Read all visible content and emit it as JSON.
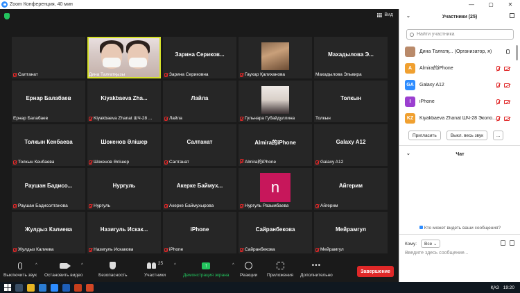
{
  "window": {
    "title": "Zoom Конференция, 40 мин",
    "controls": [
      "—",
      "▢",
      "✕"
    ]
  },
  "view_button": {
    "label": "Вид"
  },
  "tiles": [
    {
      "kind": "name",
      "center": "",
      "label": "Салтанат",
      "muted": true
    },
    {
      "kind": "camera",
      "center": "",
      "label": "Дина Талғатқызы",
      "muted": false,
      "active": true
    },
    {
      "kind": "name",
      "center": "Зарина Сериков...",
      "label": "Зарина Сериковна",
      "muted": true
    },
    {
      "kind": "photo1",
      "center": "",
      "label": "Гаухар Қалиханова",
      "muted": true
    },
    {
      "kind": "name",
      "center": "Махадылова Э...",
      "label": "Махадылова Эльвира",
      "muted": false
    },
    {
      "kind": "name",
      "center": "Ернар Балабаев",
      "label": "Ернар Балабаев",
      "muted": false
    },
    {
      "kind": "name",
      "center": "Kiyakbaeva Zha...",
      "label": "Kiyakbaeva Zhanat ШЧ-28 ...",
      "muted": true
    },
    {
      "kind": "name",
      "center": "Лайла",
      "label": "Лайла",
      "muted": true
    },
    {
      "kind": "photo2",
      "center": "",
      "label": "Гульнара Губайдуллина",
      "muted": true
    },
    {
      "kind": "name",
      "center": "Толкын",
      "label": "Толкын",
      "muted": false
    },
    {
      "kind": "name",
      "center": "Толкын Кенбаева",
      "label": "Толкын Кенбаева",
      "muted": true
    },
    {
      "kind": "name",
      "center": "Шокенов Әлішер",
      "label": "Шокенов Әлішер",
      "muted": true
    },
    {
      "kind": "name",
      "center": "Салтанат",
      "label": "Салтанат",
      "muted": true
    },
    {
      "kind": "name",
      "center": "Almira的iPhone",
      "label": "Almira的iPhone",
      "muted": true
    },
    {
      "kind": "name",
      "center": "Galaxy A12",
      "label": "Galaxy A12",
      "muted": true
    },
    {
      "kind": "name",
      "center": "Раушан Бадисо...",
      "label": "Раушан Бадисолтанова",
      "muted": true
    },
    {
      "kind": "name",
      "center": "Нургуль",
      "label": "Нургуль",
      "muted": true
    },
    {
      "kind": "name",
      "center": "Акерке Баймух...",
      "label": "Акерке Баймухырова",
      "muted": true
    },
    {
      "kind": "avatar",
      "center": "",
      "avatar": "n",
      "label": "Нургуль Разымбаева",
      "muted": true
    },
    {
      "kind": "name",
      "center": "Айгерим",
      "label": "Айгерим",
      "muted": true
    },
    {
      "kind": "name",
      "center": "Жулдыз Калиева",
      "label": "Жулдыз Калиева",
      "muted": true
    },
    {
      "kind": "name",
      "center": "Назигуль Искак...",
      "label": "Назигуль Искакова",
      "muted": true
    },
    {
      "kind": "name",
      "center": "iPhone",
      "label": "iPhone",
      "muted": true
    },
    {
      "kind": "name",
      "center": "Сайранбекова",
      "label": "Сайранбекова",
      "muted": true
    },
    {
      "kind": "name",
      "center": "Мейрамгул",
      "label": "Мейрамгул",
      "muted": true
    }
  ],
  "toolbar": {
    "mute": "Выключить звук",
    "stop_video": "Остановить видео",
    "security": "Безопасность",
    "participants": "Участники",
    "participants_count": "25",
    "share": "Демонстрация экрана",
    "reactions": "Реакции",
    "apps": "Приложения",
    "more": "Дополнительно",
    "end": "Завершение"
  },
  "panel": {
    "participants_title": "Участники (25)",
    "search_placeholder": "Найти участника",
    "participants": [
      {
        "initials": "",
        "name": "Дина Талғатқ... (Организатор, я)",
        "color": "#b98a6a",
        "photo": true,
        "mic": "on",
        "video": "on"
      },
      {
        "initials": "A",
        "name": "Almira的iPhone",
        "color": "#f0a030",
        "mic": "off",
        "video": "off"
      },
      {
        "initials": "GA",
        "name": "Galaxy A12",
        "color": "#2d8cff",
        "mic": "off",
        "video": "off"
      },
      {
        "initials": "I",
        "name": "iPhone",
        "color": "#9b3fd0",
        "mic": "off",
        "video": "off"
      },
      {
        "initials": "KZ",
        "name": "Kiyakbaeva Zhanat ШЧ-28 Эколо...",
        "color": "#f0a030",
        "mic": "off",
        "video": "off"
      }
    ],
    "invite": "Пригласить",
    "mute_all": "Выкл. весь звук",
    "more": "...",
    "chat_title": "Чат",
    "chat_who": "Кто может видеть ваши сообщения?",
    "to_label": "Кому:",
    "to_value": "Все",
    "chat_placeholder": "Введите здесь сообщение..."
  },
  "taskbar": {
    "lang": "ҚАЗ",
    "time": "19:20"
  }
}
